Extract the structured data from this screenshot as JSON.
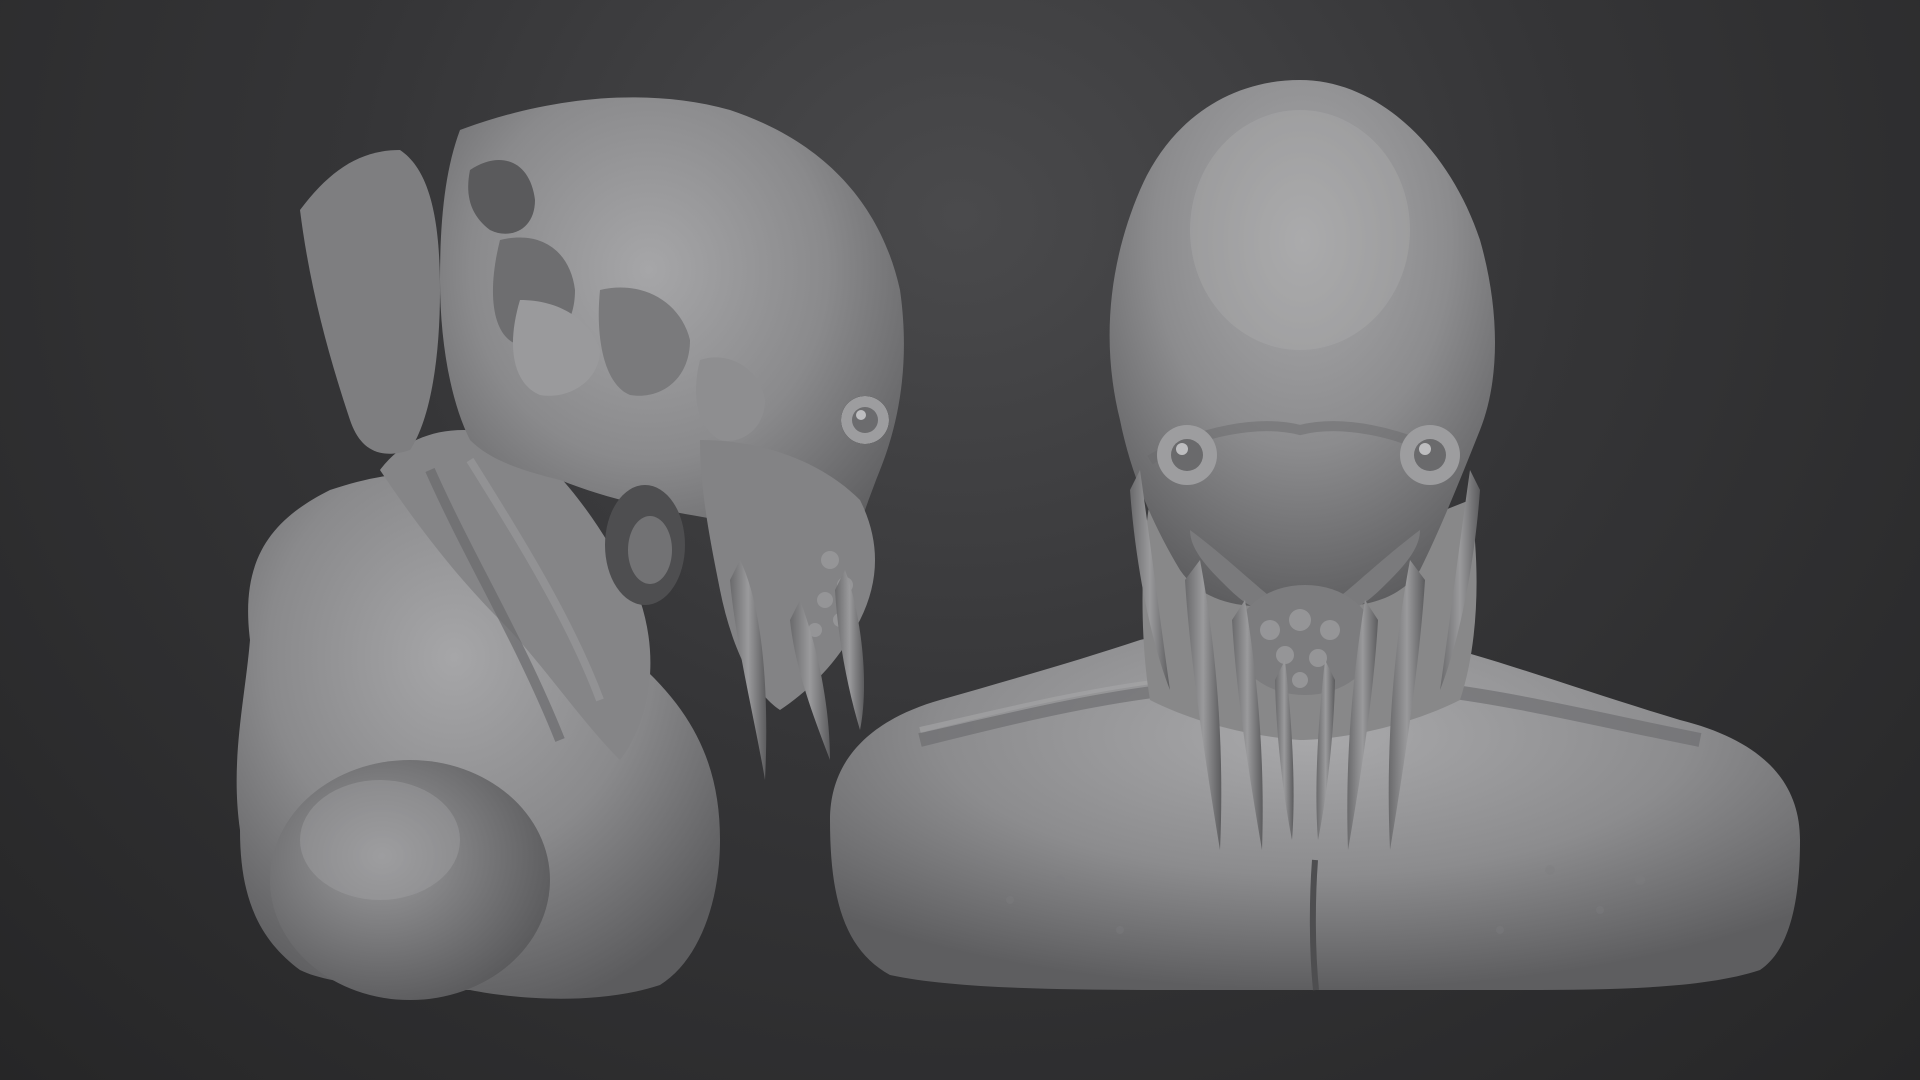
{
  "scene": {
    "background_color": "#2a2a2b",
    "material_color": "#8c8c8e",
    "shadow_color": "#4a4a4c",
    "highlight_color": "#b4b4b6",
    "views": [
      {
        "name": "side-view"
      },
      {
        "name": "front-view"
      }
    ]
  }
}
